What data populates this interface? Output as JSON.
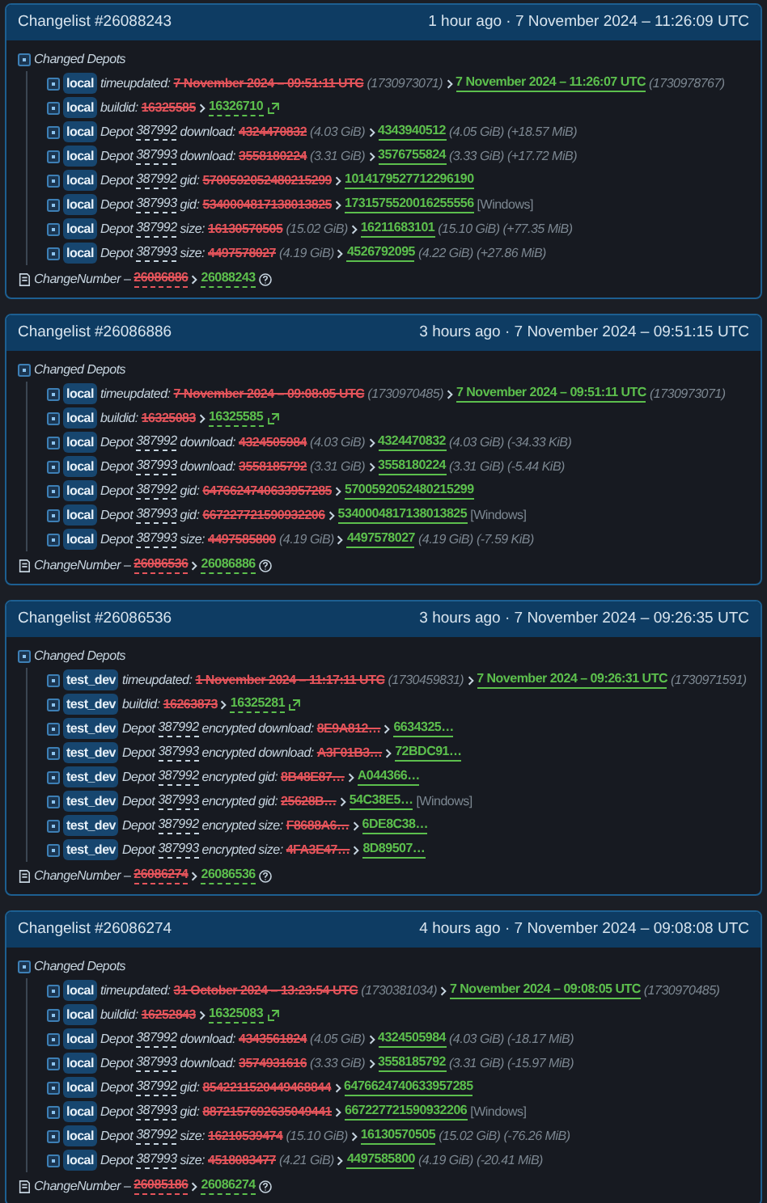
{
  "changelists": [
    {
      "title": "Changelist #26088243",
      "time": "1 hour ago · 7 November 2024 – 11:26:09 UTC",
      "section": "Changed Depots",
      "rows": [
        {
          "kind": "time",
          "branch": "local",
          "field": "timeupdated:",
          "old": "7 November 2024 – 09:51:11 UTC",
          "old_info": "(1730973071)",
          "new": "7 November 2024 – 11:26:07 UTC",
          "new_info": "(1730978767)"
        },
        {
          "kind": "build",
          "branch": "local",
          "field": "buildid:",
          "old": "16325585",
          "new": "16326710"
        },
        {
          "kind": "value",
          "branch": "local",
          "label": "Depot",
          "depot": "387992",
          "field": "download:",
          "old": "4324470832",
          "old_info": "(4.03 GiB)",
          "new": "4343940512",
          "new_info": "(4.05 GiB)",
          "delta": "(+18.57 MiB)"
        },
        {
          "kind": "value",
          "branch": "local",
          "label": "Depot",
          "depot": "387993",
          "field": "download:",
          "old": "3558180224",
          "old_info": "(3.31 GiB)",
          "new": "3576755824",
          "new_info": "(3.33 GiB)",
          "delta": "(+17.72 MiB)"
        },
        {
          "kind": "value",
          "branch": "local",
          "label": "Depot",
          "depot": "387992",
          "field": "gid:",
          "old": "5700592052480215299",
          "new": "1014179527712296190"
        },
        {
          "kind": "value",
          "branch": "local",
          "label": "Depot",
          "depot": "387993",
          "field": "gid:",
          "old": "5340004817138013825",
          "new": "1731575520016255556",
          "platform": "[Windows]"
        },
        {
          "kind": "value",
          "branch": "local",
          "label": "Depot",
          "depot": "387992",
          "field": "size:",
          "old": "16130570505",
          "old_info": "(15.02 GiB)",
          "new": "16211683101",
          "new_info": "(15.10 GiB)",
          "delta": "(+77.35 MiB)"
        },
        {
          "kind": "value",
          "branch": "local",
          "label": "Depot",
          "depot": "387993",
          "field": "size:",
          "old": "4497578027",
          "old_info": "(4.19 GiB)",
          "new": "4526792095",
          "new_info": "(4.22 GiB)",
          "delta": "(+27.86 MiB)"
        }
      ],
      "change": {
        "label": "ChangeNumber –",
        "old": "26086886",
        "new": "26088243"
      }
    },
    {
      "title": "Changelist #26086886",
      "time": "3 hours ago · 7 November 2024 – 09:51:15 UTC",
      "section": "Changed Depots",
      "rows": [
        {
          "kind": "time",
          "branch": "local",
          "field": "timeupdated:",
          "old": "7 November 2024 – 09:08:05 UTC",
          "old_info": "(1730970485)",
          "new": "7 November 2024 – 09:51:11 UTC",
          "new_info": "(1730973071)"
        },
        {
          "kind": "build",
          "branch": "local",
          "field": "buildid:",
          "old": "16325083",
          "new": "16325585"
        },
        {
          "kind": "value",
          "branch": "local",
          "label": "Depot",
          "depot": "387992",
          "field": "download:",
          "old": "4324505984",
          "old_info": "(4.03 GiB)",
          "new": "4324470832",
          "new_info": "(4.03 GiB)",
          "delta": "(-34.33 KiB)"
        },
        {
          "kind": "value",
          "branch": "local",
          "label": "Depot",
          "depot": "387993",
          "field": "download:",
          "old": "3558185792",
          "old_info": "(3.31 GiB)",
          "new": "3558180224",
          "new_info": "(3.31 GiB)",
          "delta": "(-5.44 KiB)"
        },
        {
          "kind": "value",
          "branch": "local",
          "label": "Depot",
          "depot": "387992",
          "field": "gid:",
          "old": "6476624740633957285",
          "new": "5700592052480215299"
        },
        {
          "kind": "value",
          "branch": "local",
          "label": "Depot",
          "depot": "387993",
          "field": "gid:",
          "old": "667227721590932206",
          "new": "5340004817138013825",
          "platform": "[Windows]"
        },
        {
          "kind": "value",
          "branch": "local",
          "label": "Depot",
          "depot": "387993",
          "field": "size:",
          "old": "4497585800",
          "old_info": "(4.19 GiB)",
          "new": "4497578027",
          "new_info": "(4.19 GiB)",
          "delta": "(-7.59 KiB)"
        }
      ],
      "change": {
        "label": "ChangeNumber –",
        "old": "26086536",
        "new": "26086886"
      }
    },
    {
      "title": "Changelist #26086536",
      "time": "3 hours ago · 7 November 2024 – 09:26:35 UTC",
      "section": "Changed Depots",
      "rows": [
        {
          "kind": "time",
          "branch": "test_dev",
          "field": "timeupdated:",
          "old": "1 November 2024 – 11:17:11 UTC",
          "old_info": "(1730459831)",
          "new": "7 November 2024 – 09:26:31 UTC",
          "new_info": "(1730971591)"
        },
        {
          "kind": "build",
          "branch": "test_dev",
          "field": "buildid:",
          "old": "16263873",
          "new": "16325281"
        },
        {
          "kind": "value",
          "branch": "test_dev",
          "label": "Depot",
          "depot": "387992",
          "field": "encrypted download:",
          "old": "8E9A812…",
          "new": "6634325…"
        },
        {
          "kind": "value",
          "branch": "test_dev",
          "label": "Depot",
          "depot": "387993",
          "field": "encrypted download:",
          "old": "A3F01B3…",
          "new": "72BDC91…"
        },
        {
          "kind": "value",
          "branch": "test_dev",
          "label": "Depot",
          "depot": "387992",
          "field": "encrypted gid:",
          "old": "8B48E87…",
          "new": "A044366…"
        },
        {
          "kind": "value",
          "branch": "test_dev",
          "label": "Depot",
          "depot": "387993",
          "field": "encrypted gid:",
          "old": "25628B…",
          "new": "54C38E5…",
          "platform": "[Windows]"
        },
        {
          "kind": "value",
          "branch": "test_dev",
          "label": "Depot",
          "depot": "387992",
          "field": "encrypted size:",
          "old": "F8688A6…",
          "new": "6DE8C38…"
        },
        {
          "kind": "value",
          "branch": "test_dev",
          "label": "Depot",
          "depot": "387993",
          "field": "encrypted size:",
          "old": "4FA3E47…",
          "new": "8D89507…"
        }
      ],
      "change": {
        "label": "ChangeNumber –",
        "old": "26086274",
        "new": "26086536"
      }
    },
    {
      "title": "Changelist #26086274",
      "time": "4 hours ago · 7 November 2024 – 09:08:08 UTC",
      "section": "Changed Depots",
      "rows": [
        {
          "kind": "time",
          "branch": "local",
          "field": "timeupdated:",
          "old": "31 October 2024 – 13:23:54 UTC",
          "old_info": "(1730381034)",
          "new": "7 November 2024 – 09:08:05 UTC",
          "new_info": "(1730970485)"
        },
        {
          "kind": "build",
          "branch": "local",
          "field": "buildid:",
          "old": "16252843",
          "new": "16325083"
        },
        {
          "kind": "value",
          "branch": "local",
          "label": "Depot",
          "depot": "387992",
          "field": "download:",
          "old": "4343561824",
          "old_info": "(4.05 GiB)",
          "new": "4324505984",
          "new_info": "(4.03 GiB)",
          "delta": "(-18.17 MiB)"
        },
        {
          "kind": "value",
          "branch": "local",
          "label": "Depot",
          "depot": "387993",
          "field": "download:",
          "old": "3574931616",
          "old_info": "(3.33 GiB)",
          "new": "3558185792",
          "new_info": "(3.31 GiB)",
          "delta": "(-15.97 MiB)"
        },
        {
          "kind": "value",
          "branch": "local",
          "label": "Depot",
          "depot": "387992",
          "field": "gid:",
          "old": "8542211520449468844",
          "new": "6476624740633957285"
        },
        {
          "kind": "value",
          "branch": "local",
          "label": "Depot",
          "depot": "387993",
          "field": "gid:",
          "old": "8872157692635049441",
          "new": "667227721590932206",
          "platform": "[Windows]"
        },
        {
          "kind": "value",
          "branch": "local",
          "label": "Depot",
          "depot": "387992",
          "field": "size:",
          "old": "16210539474",
          "old_info": "(15.10 GiB)",
          "new": "16130570505",
          "new_info": "(15.02 GiB)",
          "delta": "(-76.26 MiB)"
        },
        {
          "kind": "value",
          "branch": "local",
          "label": "Depot",
          "depot": "387993",
          "field": "size:",
          "old": "4518083477",
          "old_info": "(4.21 GiB)",
          "new": "4497585800",
          "new_info": "(4.19 GiB)",
          "delta": "(-20.41 MiB)"
        }
      ],
      "change": {
        "label": "ChangeNumber –",
        "old": "26085186",
        "new": "26086274"
      }
    }
  ]
}
